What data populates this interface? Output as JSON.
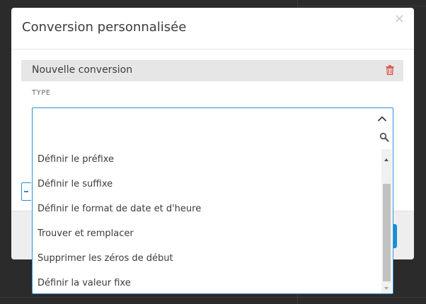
{
  "dialog": {
    "title": "Conversion personnalisée",
    "close_label": "×"
  },
  "conversion": {
    "name": "Nouvelle conversion"
  },
  "type_field": {
    "label": "TYPE",
    "options": [
      "Définir le préfixe",
      "Définir le suffixe",
      "Définir le format de date et d'heure",
      "Trouver et remplacer",
      "Supprimer les zéros de début",
      "Définir la valeur fixe"
    ]
  },
  "colors": {
    "accent": "#2d8fd5",
    "danger": "#e0423a",
    "header_bar": "#e6e6e6"
  }
}
